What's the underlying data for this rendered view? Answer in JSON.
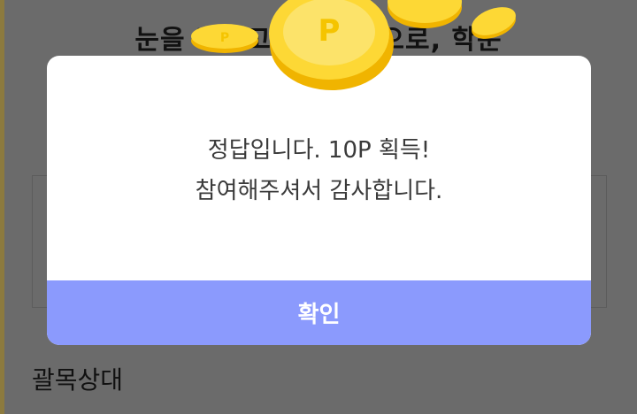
{
  "page": {
    "question_text": "눈을 비비고 … 는 뜻으로, 학문",
    "bottom_word": "괄목상대"
  },
  "modal": {
    "message_line1": "정답입니다. 10P 획득!",
    "message_line2": "참여해주셔서 감사합니다.",
    "confirm_label": "확인"
  },
  "colors": {
    "overlay": "#6b6b6b",
    "confirm_button": "#8b9afd",
    "coin_gold": "#fdd835",
    "coin_shadow": "#f0b400"
  },
  "icons": {
    "coin": "coin-icon",
    "coin_mark": "P"
  }
}
